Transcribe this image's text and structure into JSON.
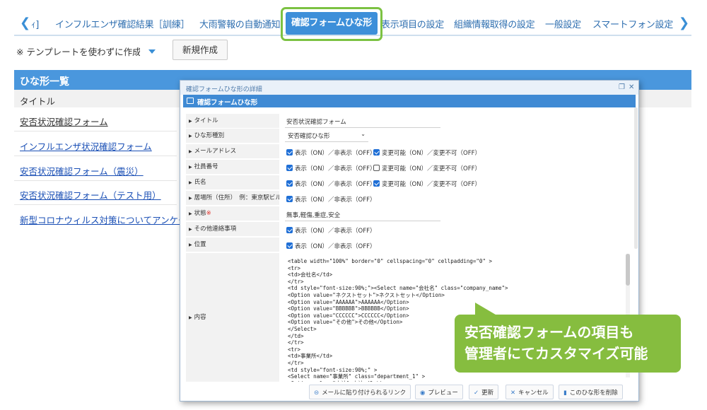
{
  "tabs": {
    "left_partial": "ｨ]",
    "items": [
      "インフルエンザ確認結果［訓練］",
      "大雨警報の自動通知",
      "確認フォームひな形",
      "表示項目の設定",
      "組織情報取得の設定",
      "一般設定",
      "スマートフォン設定"
    ],
    "active_index": 2
  },
  "toolbar": {
    "notice": "※ テンプレートを使わずに作成",
    "new_button": "新規作成"
  },
  "template_list": {
    "header": "ひな形一覧",
    "column": "タイトル",
    "items": [
      "安否状況確認フォーム",
      "インフルエンザ状況確認フォーム",
      "安否状況確認フォーム（震災）",
      "安否状況確認フォーム（テスト用）",
      "新型コロナウィルス対策についてアンケート"
    ]
  },
  "modal": {
    "window_title": "確認フォームひな形の詳細",
    "panel_title": "確認フォームひな形",
    "rows": [
      {
        "label": "タイトル",
        "value": "安否状況確認フォーム"
      },
      {
        "label": "ひな形種別",
        "value": "安否確認ひな形"
      },
      {
        "label": "メールアドレス",
        "display": "表示（ON）／非表示（OFF）",
        "change": "変更可能（ON）／変更不可（OFF）"
      },
      {
        "label": "社員番号",
        "display": "表示（ON）／非表示（OFF）",
        "change": "変更可能（ON）／変更不可（OFF）"
      },
      {
        "label": "氏名",
        "display": "表示（ON）／非表示（OFF）",
        "change": "変更可能（ON）／変更不可（OFF）"
      },
      {
        "label": "居場所（住所）　例：東京駅ビル",
        "display": "表示（ON）／非表示（OFF）"
      },
      {
        "label": "状態",
        "required": "※",
        "value": "無事,軽傷,重症,安全"
      },
      {
        "label": "その他連絡事項",
        "display": "表示（ON）／非表示（OFF）"
      },
      {
        "label": "位置",
        "display": "表示（ON）／非表示（OFF）"
      },
      {
        "label": "内容"
      }
    ],
    "checkboxes": {
      "email_display": true,
      "email_change": true,
      "employee_display": true,
      "employee_change": false,
      "name_display": true,
      "name_change": true,
      "location_display": true,
      "other_display": true,
      "position_display": true
    },
    "code_lines": [
      "<table width=\"100%\" border=\"0\" cellspacing=\"0\" cellpadding=\"0\" >",
      "<tr>",
      "<td>会社名</td>",
      "</tr>",
      "<td style=\"font-size:90%;\"><Select name=\"会社名\" class=\"company_name\">",
      "<Option value=\"ネクストセット\">ネクストセット</Option>",
      "<Option value=\"AAAAAA\">AAAAAA</Option>",
      "<Option value=\"BBBBBB\">BBBBBB</Option>",
      "<Option value=\"CCCCCC\">CCCCCC</Option>",
      "<Option value=\"その他\">その他</Option>",
      "</Select>",
      "</td>",
      "</tr>",
      "<tr>",
      "<td>事業所</td>",
      "</tr>",
      "<td style=\"font-size:90%;\" >",
      "<Select name=\"事業所\" class=\"department_1\" >",
      "<Option value=\"本社\">本社</Option>"
    ],
    "footer_buttons": [
      "メールに貼り付けられるリンク",
      "プレビュー",
      "更新",
      "キャンセル",
      "このひな形を削除"
    ]
  },
  "callout": {
    "line1": "安否確認フォームの項目も",
    "line2": "管理者にてカスタマイズ可能"
  },
  "colors": {
    "accent": "#3d8fd9",
    "highlight": "#7cc242",
    "callout": "#86bd3f"
  }
}
